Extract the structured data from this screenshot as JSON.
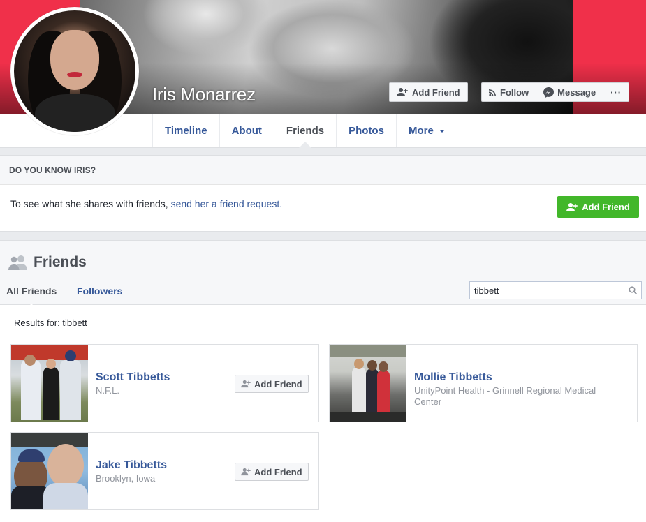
{
  "profile": {
    "name": "Iris Monarrez",
    "add_friend_label": "Add Friend",
    "follow_label": "Follow",
    "message_label": "Message",
    "more_label": "···"
  },
  "nav": {
    "tabs": [
      {
        "label": "Timeline"
      },
      {
        "label": "About"
      },
      {
        "label": "Friends"
      },
      {
        "label": "Photos"
      },
      {
        "label": "More"
      }
    ]
  },
  "know": {
    "heading": "DO YOU KNOW IRIS?",
    "text": "To see what she shares with friends, ",
    "link": "send her a friend request.",
    "button": "Add Friend"
  },
  "friends": {
    "title": "Friends",
    "tab_all": "All Friends",
    "tab_followers": "Followers",
    "search_value": "tibbett",
    "results_label": "Results for: tibbett",
    "people": [
      {
        "name": "Scott Tibbetts",
        "sub": "N.F.L.",
        "button": "Add Friend"
      },
      {
        "name": "Mollie Tibbetts",
        "sub": "UnityPoint Health - Grinnell Regional Medical Center",
        "button": ""
      },
      {
        "name": "Jake Tibbetts",
        "sub": "Brooklyn, Iowa",
        "button": "Add Friend"
      }
    ]
  },
  "colors": {
    "link": "#365899",
    "green": "#42b72a",
    "cover": "#f0304a"
  }
}
